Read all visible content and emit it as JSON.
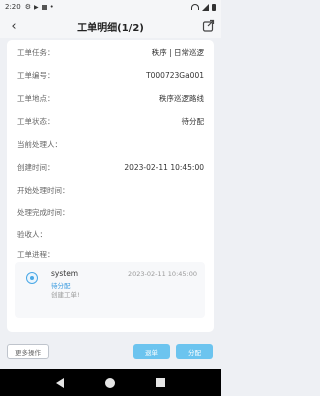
{
  "status_bar": {
    "time": "2:20",
    "icons": [
      "settings-icon",
      "play-icon",
      "notification-icon",
      "dot-icon"
    ],
    "right_icons": [
      "wifi-icon",
      "signal-icon",
      "battery-icon"
    ]
  },
  "header": {
    "title": "工单明细(1/2)",
    "back_icon": "chevron-left-icon",
    "share_icon": "share-icon"
  },
  "details": [
    {
      "label": "工单任务：",
      "value": "秩序 | 日常巡逻"
    },
    {
      "label": "工单编号：",
      "value": "T000723Ga001"
    },
    {
      "label": "工单地点：",
      "value": "秩序巡逻路线"
    },
    {
      "label": "工单状态：",
      "value": "待分配"
    },
    {
      "label": "当前处理人：",
      "value": ""
    },
    {
      "label": "创建时间：",
      "value": "2023-02-11 10:45:00"
    },
    {
      "label": "开始处理时间：",
      "value": ""
    },
    {
      "label": "处理完成时间：",
      "value": ""
    },
    {
      "label": "验收人：",
      "value": ""
    },
    {
      "label": "工单进程：",
      "value": ""
    }
  ],
  "process_log": {
    "user": "system",
    "time": "2023-02-11 10:45:00",
    "action": "待分配",
    "note": "创建工单!"
  },
  "actions": {
    "more": "更多操作",
    "reject": "退单",
    "assign": "分配"
  },
  "colors": {
    "accent": "#6cc4ef",
    "link": "#3a9be0",
    "background": "#eef0f4"
  }
}
